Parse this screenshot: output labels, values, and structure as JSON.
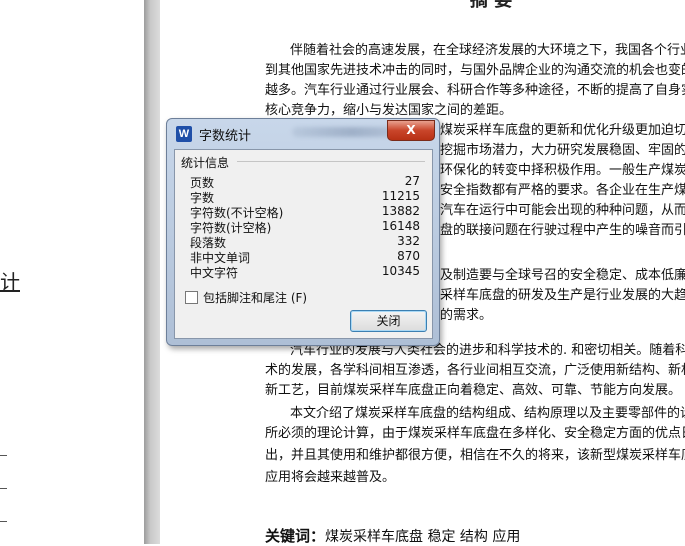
{
  "document": {
    "left_fragment": "计",
    "title": "摘  要",
    "lines": [
      {
        "text": "伴随着社会的高速发展，在全球经济发展的大环境之下，我国各个行业",
        "indent": true
      },
      {
        "text": "到其他国家先进技术冲击的同时，与国外品牌企业的沟通交流的机会也变的",
        "indent": false
      },
      {
        "text": "越多。汽车行业通过行业展会、科研合作等多种途径，不断的提高了自身实",
        "indent": false
      },
      {
        "text": "核心竞争力，缩小与发达国家之间的差距。",
        "indent": false
      },
      {
        "text": "煤炭采样车底盘的更新和优化升级更加迫切",
        "indent": false
      },
      {
        "text": "挖掘市场潜力，大力研究发展稳固、牢固的",
        "indent": false
      },
      {
        "text": "环保化的转变中择积极作用。一般生产煤炭",
        "indent": false
      },
      {
        "text": "安全指数都有严格的要求。各企业在生产煤",
        "indent": false
      },
      {
        "text": "汽车在运行中可能会出现的种种问题，从而",
        "indent": false
      },
      {
        "text": "盘的联接问题在行驶过程中产生的噪音而引",
        "indent": false
      },
      {
        "text": "及制造要与全球号召的安全稳定、成本低廉",
        "indent": false
      },
      {
        "text": "采样车底盘的研发及生产是行业发展的大趋",
        "indent": false
      },
      {
        "text": "的需求。",
        "indent": false
      },
      {
        "text": "汽车行业的发展与人类社会的进步和科学技术的. 和密切相关。随着科",
        "indent": true
      },
      {
        "text": "术的发展，各学科间相互渗透，各行业间相互交流，广泛使用新结构、新材",
        "indent": false
      },
      {
        "text": "新工艺，目前煤炭采样车底盘正向着稳定、高效、可靠、节能方向发展。",
        "indent": false
      },
      {
        "text": "本文介绍了煤炭采样车底盘的结构组成、结构原理以及主要零部件的设",
        "indent": true
      },
      {
        "text": "所必须的理论计算，由于煤炭采样车底盘在多样化、安全稳定方面的优点日",
        "indent": false
      },
      {
        "text": "出，并且其使用和维护都很方便，相信在不久的将来，该新型煤炭采样车底",
        "indent": false
      },
      {
        "text": "应用将会越来越普及。",
        "indent": false
      }
    ],
    "keywords_label": "关键词：",
    "keywords_value": "煤炭采样车底盘 稳定 结构 应用"
  },
  "dialog": {
    "icon_letter": "W",
    "title": "字数统计",
    "close_label": "X",
    "group_label": "统计信息",
    "stats": [
      {
        "label": "页数",
        "value": "27"
      },
      {
        "label": "字数",
        "value": "11215"
      },
      {
        "label": "字符数(不计空格)",
        "value": "13882"
      },
      {
        "label": "字符数(计空格)",
        "value": "16148"
      },
      {
        "label": "段落数",
        "value": "332"
      },
      {
        "label": "非中文单词",
        "value": "870"
      },
      {
        "label": "中文字符",
        "value": "10345"
      }
    ],
    "checkbox_label": "包括脚注和尾注 (F)",
    "checkbox_checked": false,
    "ok_label": "关闭"
  }
}
